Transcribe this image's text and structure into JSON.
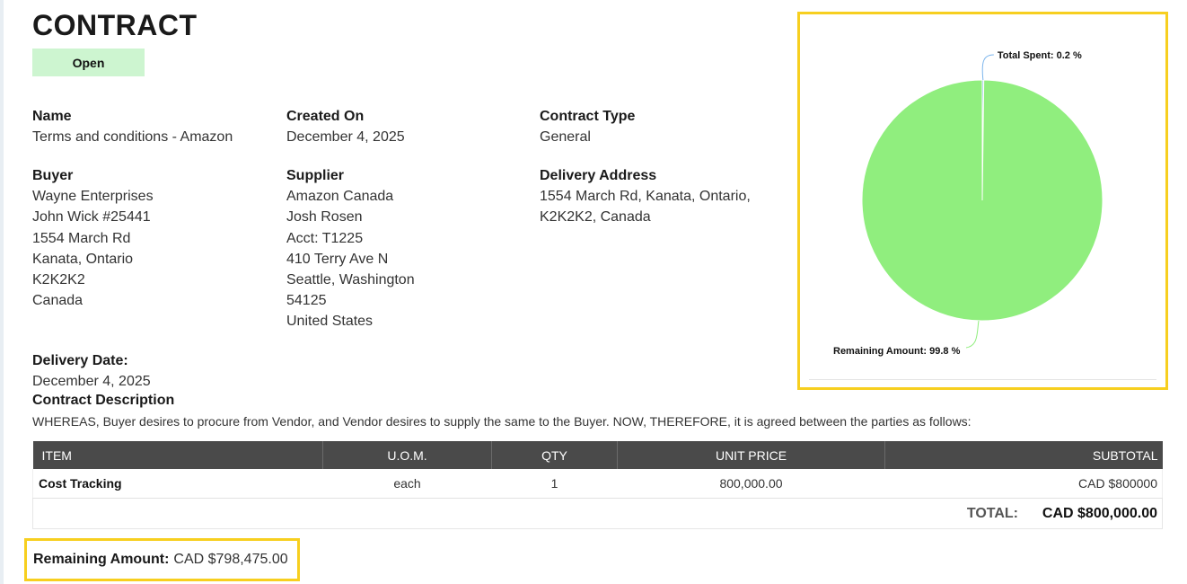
{
  "page": {
    "title": "CONTRACT",
    "status": "Open"
  },
  "fields": {
    "name": {
      "label": "Name",
      "lines": [
        "Terms and conditions - Amazon"
      ]
    },
    "created_on": {
      "label": "Created On",
      "lines": [
        "December 4, 2025"
      ]
    },
    "contract_type": {
      "label": "Contract Type",
      "lines": [
        "General"
      ]
    },
    "buyer": {
      "label": "Buyer",
      "lines": [
        "Wayne Enterprises",
        "John Wick #25441",
        "1554 March Rd",
        "Kanata, Ontario",
        "K2K2K2",
        "Canada"
      ]
    },
    "supplier": {
      "label": "Supplier",
      "lines": [
        "Amazon Canada",
        "Josh Rosen",
        "Acct: T1225",
        "410 Terry Ave N",
        "Seattle, Washington",
        "54125",
        "United States"
      ]
    },
    "delivery_address": {
      "label": "Delivery Address",
      "lines": [
        "1554 March Rd, Kanata, Ontario,",
        "K2K2K2, Canada"
      ]
    },
    "delivery_date": {
      "label": "Delivery Date:",
      "lines": [
        "December 4, 2025"
      ]
    }
  },
  "description": {
    "label": "Contract Description",
    "text": "WHEREAS, Buyer desires to procure from Vendor, and Vendor desires to supply the same to the Buyer. NOW, THEREFORE, it is agreed between the parties as follows:"
  },
  "items_table": {
    "headers": [
      "ITEM",
      "U.O.M.",
      "QTY",
      "UNIT PRICE",
      "SUBTOTAL"
    ],
    "rows": [
      [
        "Cost Tracking",
        "each",
        "1",
        "800,000.00",
        "CAD $800000"
      ]
    ],
    "total_label": "TOTAL:",
    "total_value": "CAD $800,000.00"
  },
  "remaining": {
    "label": "Remaining Amount:",
    "value": "CAD $798,475.00"
  },
  "colors": {
    "status_bg": "#cdf5d0",
    "highlight_border": "#f7cf1f",
    "table_header_bg": "#4a4a4a",
    "pie_remaining": "#90ee7e",
    "pie_spent": "#7cb5ec"
  },
  "chart_data": {
    "type": "pie",
    "categories": [
      "Total Spent",
      "Remaining Amount"
    ],
    "values": [
      0.2,
      99.8
    ],
    "data_labels": [
      "Total Spent: 0.2 %",
      "Remaining Amount: 99.8 %"
    ]
  }
}
